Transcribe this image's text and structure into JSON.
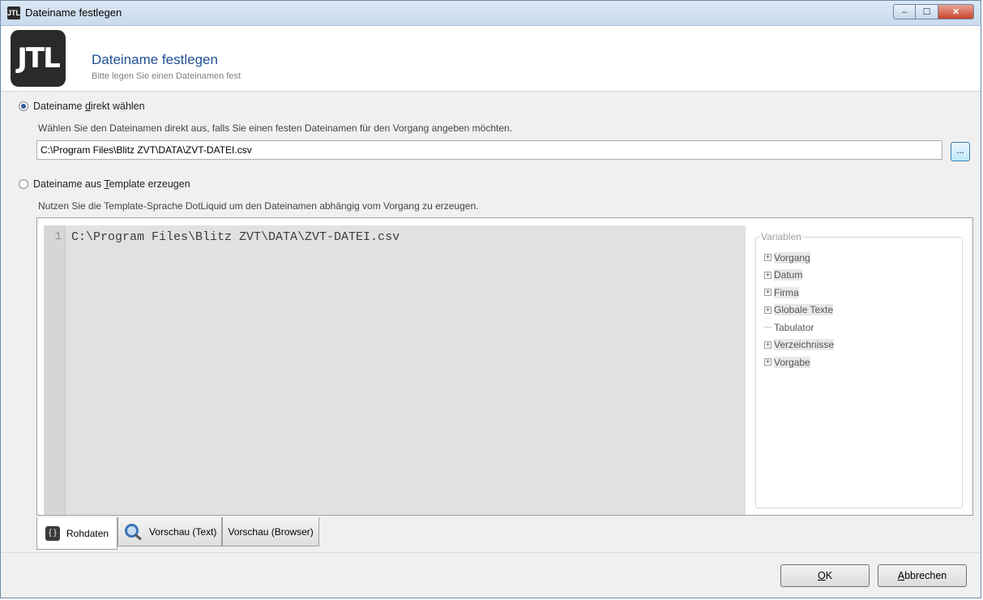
{
  "window": {
    "title": "Dateiname festlegen",
    "logo_text": "JTL",
    "controls": {
      "minimize": "–",
      "maximize": "☐",
      "close": "✕"
    }
  },
  "header": {
    "logo_text": "JTL",
    "title": "Dateiname festlegen",
    "subtitle": "Bitte legen Sie einen Dateinamen fest"
  },
  "option_direct": {
    "label_pre": "Dateiname ",
    "label_accel": "d",
    "label_post": "irekt wählen",
    "checked": true,
    "description": "Wählen Sie den Dateinamen direkt aus, falls Sie einen festen Dateinamen für den Vorgang angeben möchten.",
    "path_value": "C:\\Program Files\\Blitz ZVT\\DATA\\ZVT-DATEI.csv",
    "browse_label": "..."
  },
  "option_template": {
    "label_pre": "Dateiname aus ",
    "label_accel": "T",
    "label_post": "emplate erzeugen",
    "checked": false,
    "description": "Nutzen Sie die Template-Sprache DotLiquid um den Dateinamen abhängig vom Vorgang zu erzeugen."
  },
  "editor": {
    "line_number": "1",
    "code": "C:\\Program Files\\Blitz ZVT\\DATA\\ZVT-DATEI.csv"
  },
  "variables": {
    "legend": "Variablen",
    "items": [
      {
        "label": "Vorgang",
        "expandable": true
      },
      {
        "label": "Datum",
        "expandable": true
      },
      {
        "label": "Firma",
        "expandable": true
      },
      {
        "label": "Globale Texte",
        "expandable": true
      },
      {
        "label": "Tabulator",
        "expandable": false
      },
      {
        "label": "Verzeichnisse",
        "expandable": true
      },
      {
        "label": "Vorgabe",
        "expandable": true
      }
    ]
  },
  "tabs": {
    "raw": "Rohdaten",
    "preview_text": "Vorschau (Text)",
    "preview_browser": "Vorschau (Browser)",
    "raw_icon": "{ }"
  },
  "footer": {
    "ok_accel": "O",
    "ok_rest": "K",
    "cancel_accel": "A",
    "cancel_rest": "bbrechen"
  }
}
